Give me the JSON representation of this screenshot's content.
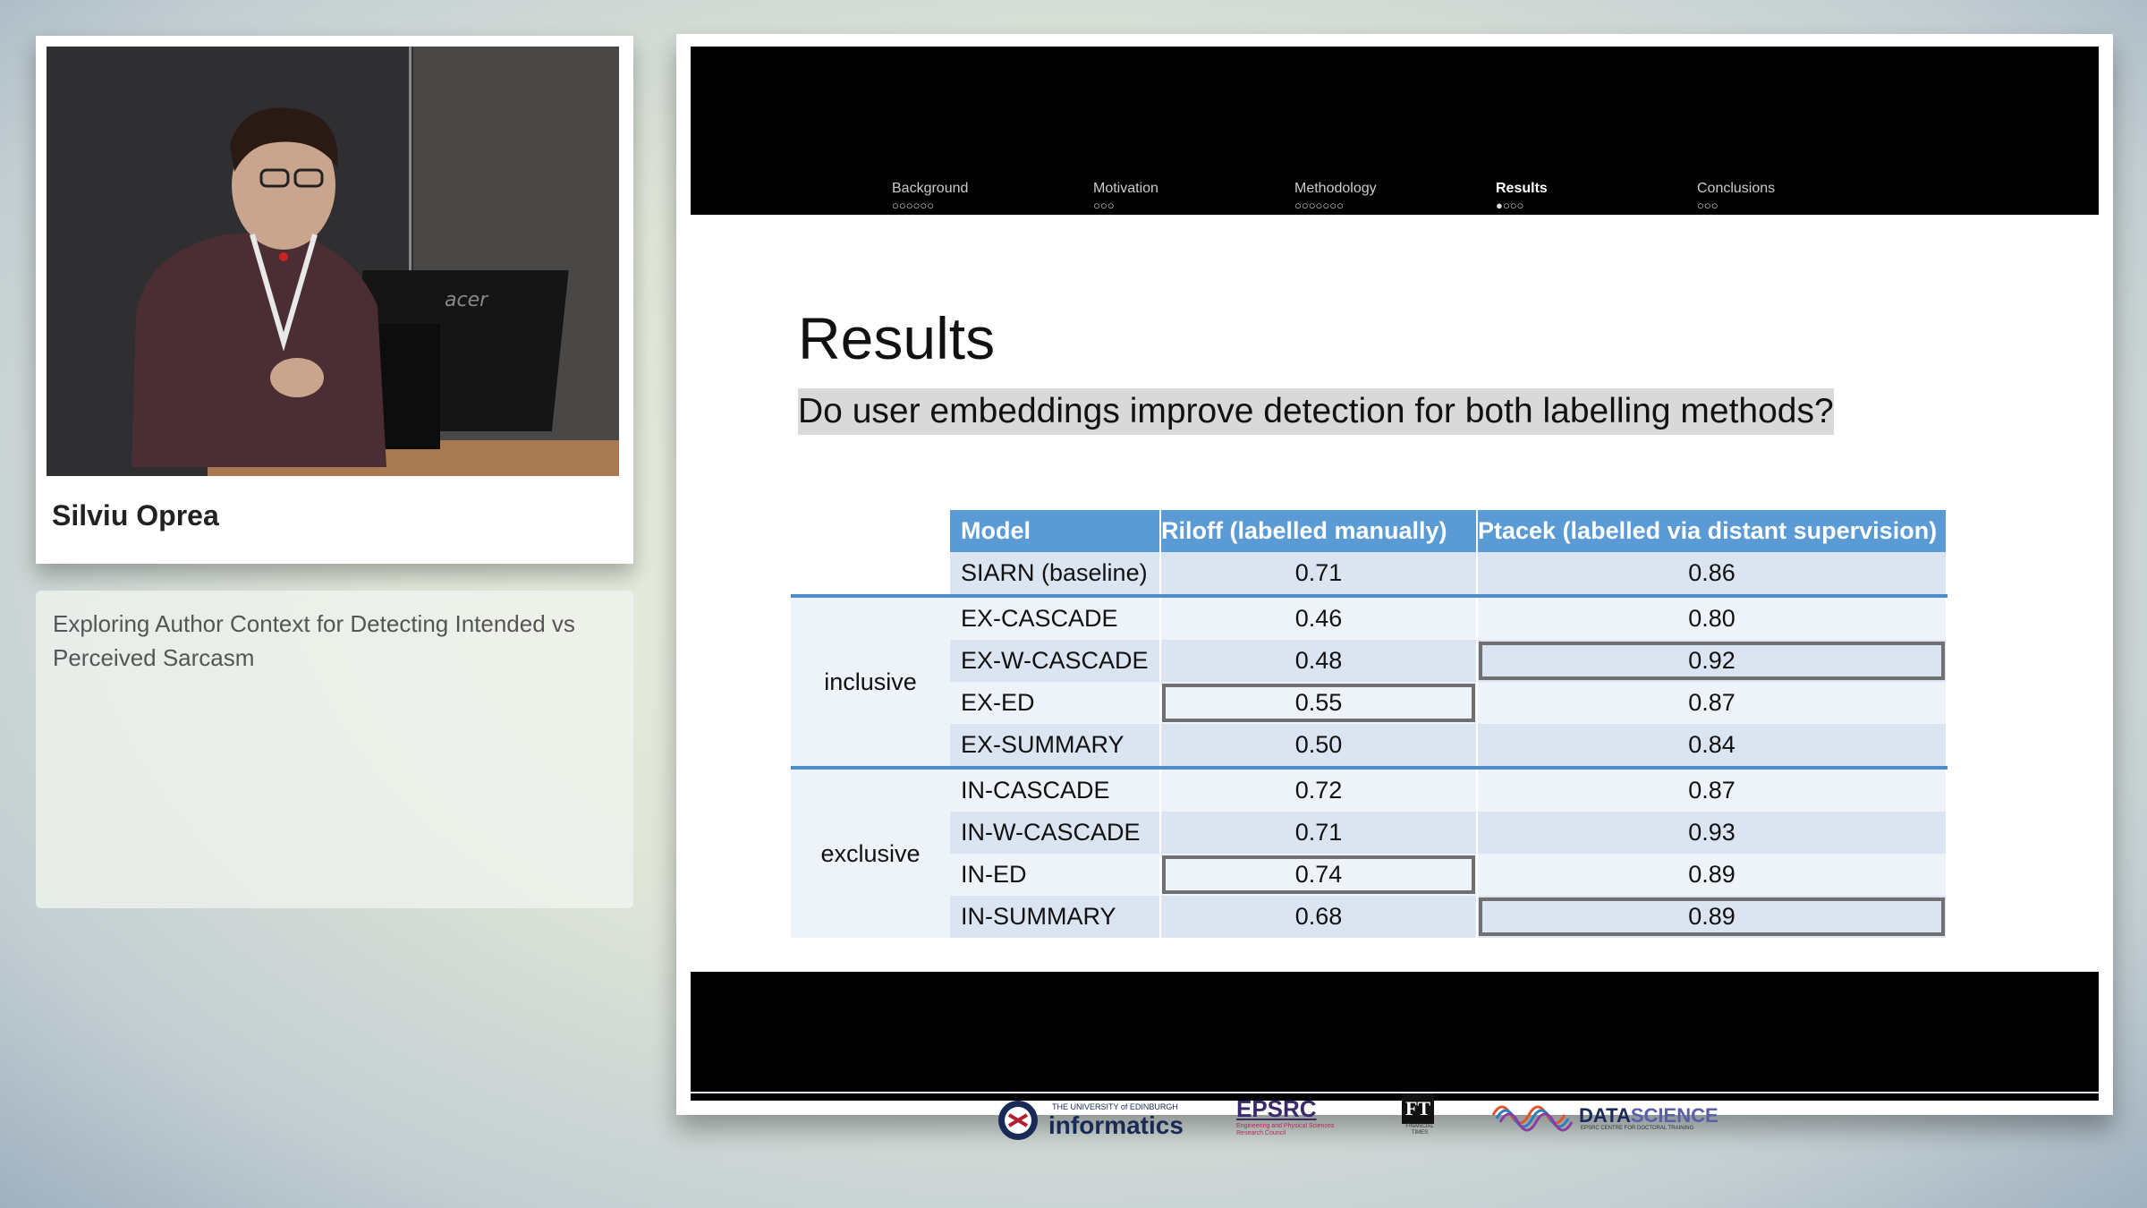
{
  "speaker": {
    "name": "Silviu Oprea",
    "laptop_brand": "acer"
  },
  "talk": {
    "title": "Exploring Author Context for Detecting Intended vs Perceived Sarcasm"
  },
  "slide": {
    "nav": [
      {
        "label": "Background",
        "dots": "○○○○○○"
      },
      {
        "label": "Motivation",
        "dots": "○○○"
      },
      {
        "label": "Methodology",
        "dots": "○○○○○○○"
      },
      {
        "label": "Results",
        "dots": "●○○○",
        "active": true
      },
      {
        "label": "Conclusions",
        "dots": "○○○"
      }
    ],
    "title": "Results",
    "question": "Do user embeddings improve detection for both labelling methods?",
    "table": {
      "headers": [
        "Model",
        "Riloff (labelled manually)",
        "Ptacek (labelled via distant supervision)"
      ],
      "baseline": {
        "model": "SIARN (baseline)",
        "riloff": "0.71",
        "ptacek": "0.86"
      },
      "groups": [
        {
          "label": "inclusive",
          "rows": [
            {
              "model": "EX-CASCADE",
              "riloff": "0.46",
              "ptacek": "0.80"
            },
            {
              "model": "EX-W-CASCADE",
              "riloff": "0.48",
              "ptacek": "0.92"
            },
            {
              "model": "EX-ED",
              "riloff": "0.55",
              "ptacek": "0.87"
            },
            {
              "model": "EX-SUMMARY",
              "riloff": "0.50",
              "ptacek": "0.84"
            }
          ]
        },
        {
          "label": "exclusive",
          "rows": [
            {
              "model": "IN-CASCADE",
              "riloff": "0.72",
              "ptacek": "0.87"
            },
            {
              "model": "IN-W-CASCADE",
              "riloff": "0.71",
              "ptacek": "0.93"
            },
            {
              "model": "IN-ED",
              "riloff": "0.74",
              "ptacek": "0.89"
            },
            {
              "model": "IN-SUMMARY",
              "riloff": "0.68",
              "ptacek": "0.89"
            }
          ]
        }
      ]
    },
    "logos": {
      "edinburgh_small": "THE UNIVERSITY of EDINBURGH",
      "edinburgh": "informatics",
      "epsrc": "EPSRC",
      "epsrc_sub": "Engineering and Physical Sciences Research Council",
      "ft": "FT",
      "ft_sub": "FINANCIAL TIMES",
      "datascience_a": "DATA",
      "datascience_b": "SCIENCE",
      "datascience_sub": "EPSRC CENTRE FOR DOCTORAL TRAINING"
    }
  },
  "colors": {
    "header_blue": "#5b9bd5",
    "band_light": "#dbe5f2",
    "band_lighter": "#eef3f9",
    "separator_blue": "#4f8ccc",
    "highlight_border": "#707070"
  }
}
